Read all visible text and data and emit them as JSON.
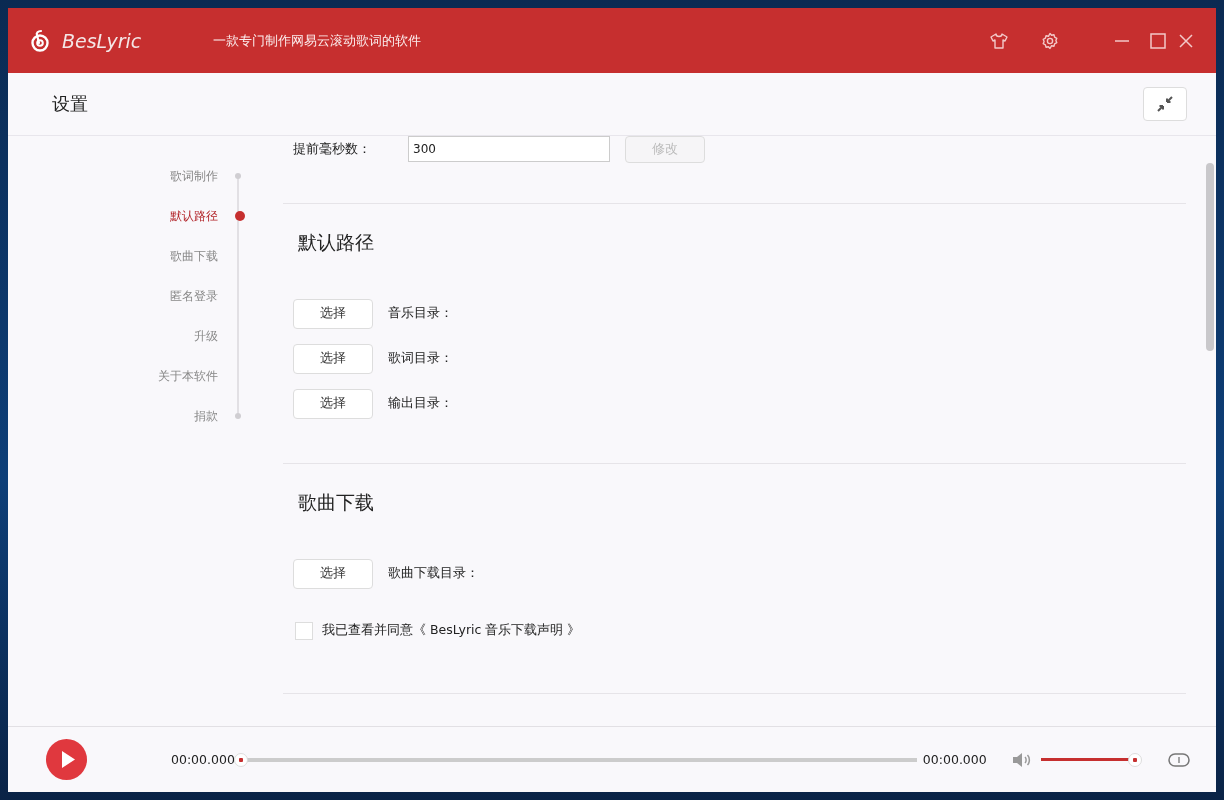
{
  "window": {
    "app_name": "BesLyric",
    "tagline": "一款专门制作网易云滚动歌词的软件"
  },
  "page_title": "设置",
  "sidebar": {
    "items": [
      {
        "label": "歌词制作",
        "selected": false
      },
      {
        "label": "默认路径",
        "selected": true
      },
      {
        "label": "歌曲下载",
        "selected": false
      },
      {
        "label": "匿名登录",
        "selected": false
      },
      {
        "label": "升级",
        "selected": false
      },
      {
        "label": "关于本软件",
        "selected": false
      },
      {
        "label": "捐款",
        "selected": false
      }
    ]
  },
  "sections": [
    {
      "rows": [
        {
          "kind": "input",
          "label": "提前毫秒数：",
          "value": "300",
          "button": "修改",
          "disabled": true
        }
      ]
    },
    {
      "title": "默认路径",
      "rows": [
        {
          "kind": "path",
          "button": "选择",
          "label": "音乐目录："
        },
        {
          "kind": "path",
          "button": "选择",
          "label": "歌词目录："
        },
        {
          "kind": "path",
          "button": "选择",
          "label": "输出目录："
        }
      ]
    },
    {
      "title": "歌曲下载",
      "rows": [
        {
          "kind": "path",
          "button": "选择",
          "label": "歌曲下载目录："
        },
        {
          "kind": "checkbox",
          "label": "我已查看并同意《 BesLyric 音乐下载声明 》",
          "checked": false
        }
      ]
    }
  ],
  "player": {
    "playing": false,
    "current_time": "00:00.000",
    "total_time": "00:00.000",
    "progress": {
      "level": 0
    },
    "volume": {
      "level": 1
    }
  }
}
